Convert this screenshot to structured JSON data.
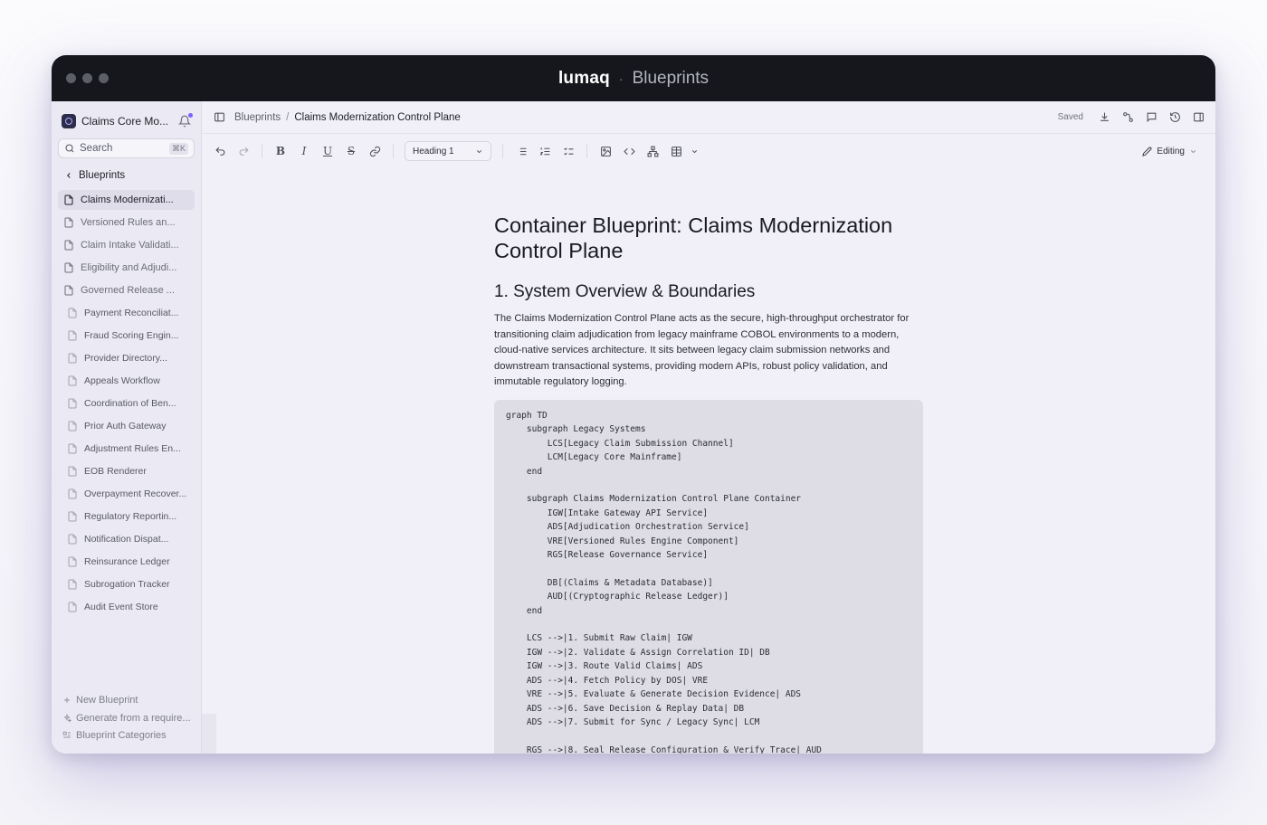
{
  "window": {
    "brand": "lumaq",
    "separator": "·",
    "section": "Blueprints"
  },
  "sidebar": {
    "workspace": "Claims Core Mo...",
    "search_placeholder": "Search",
    "search_shortcut": "⌘K",
    "back_label": "Blueprints",
    "items": [
      {
        "label": "Claims Modernizati...",
        "active": true
      },
      {
        "label": "Versioned Rules an..."
      },
      {
        "label": "Claim Intake Validati..."
      },
      {
        "label": "Eligibility and Adjudi..."
      },
      {
        "label": "Governed Release ..."
      }
    ],
    "child_items": [
      {
        "label": "Payment Reconciliat..."
      },
      {
        "label": "Fraud Scoring Engin..."
      },
      {
        "label": "Provider Directory..."
      },
      {
        "label": "Appeals Workflow"
      },
      {
        "label": "Coordination of Ben..."
      },
      {
        "label": "Prior Auth Gateway"
      },
      {
        "label": "Adjustment Rules En..."
      },
      {
        "label": "EOB Renderer"
      },
      {
        "label": "Overpayment Recover..."
      },
      {
        "label": "Regulatory Reportin..."
      },
      {
        "label": "Notification Dispat..."
      },
      {
        "label": "Reinsurance Ledger"
      },
      {
        "label": "Subrogation Tracker"
      },
      {
        "label": "Audit Event Store"
      }
    ],
    "footer": {
      "new_blueprint": "New Blueprint",
      "generate": "Generate from a require...",
      "categories": "Blueprint Categories"
    }
  },
  "topbar": {
    "breadcrumb_root": "Blueprints",
    "breadcrumb_sep": "/",
    "breadcrumb_current": "Claims Modernization Control Plane",
    "status": "Saved"
  },
  "toolbar": {
    "heading_select": "Heading 1",
    "bold": "B",
    "italic": "I",
    "underline": "U",
    "strike": "S",
    "mode": "Editing"
  },
  "document": {
    "title": "Container Blueprint: Claims Modernization Control Plane",
    "section_heading": "1. System Overview & Boundaries",
    "paragraph": "The Claims Modernization Control Plane acts as the secure, high-throughput orchestrator for transitioning claim adjudication from legacy mainframe COBOL environments to a modern, cloud-native services architecture. It sits between legacy claim submission networks and downstream transactional systems, providing modern APIs, robust policy validation, and immutable regulatory logging.",
    "code": "graph TD\n    subgraph Legacy Systems\n        LCS[Legacy Claim Submission Channel]\n        LCM[Legacy Core Mainframe]\n    end\n\n    subgraph Claims Modernization Control Plane Container\n        IGW[Intake Gateway API Service]\n        ADS[Adjudication Orchestration Service]\n        VRE[Versioned Rules Engine Component]\n        RGS[Release Governance Service]\n\n        DB[(Claims & Metadata Database)]\n        AUD[(Cryptographic Release Ledger)]\n    end\n\n    LCS -->|1. Submit Raw Claim| IGW\n    IGW -->|2. Validate & Assign Correlation ID| DB\n    IGW -->|3. Route Valid Claims| ADS\n    ADS -->|4. Fetch Policy by DOS| VRE\n    VRE -->|5. Evaluate & Generate Decision Evidence| ADS\n    ADS -->|6. Save Decision & Replay Data| DB\n    ADS -->|7. Submit for Sync / Legacy Sync| LCM\n\n    RGS -->|8. Seal Release Configuration & Verify Trace| AUD"
  }
}
